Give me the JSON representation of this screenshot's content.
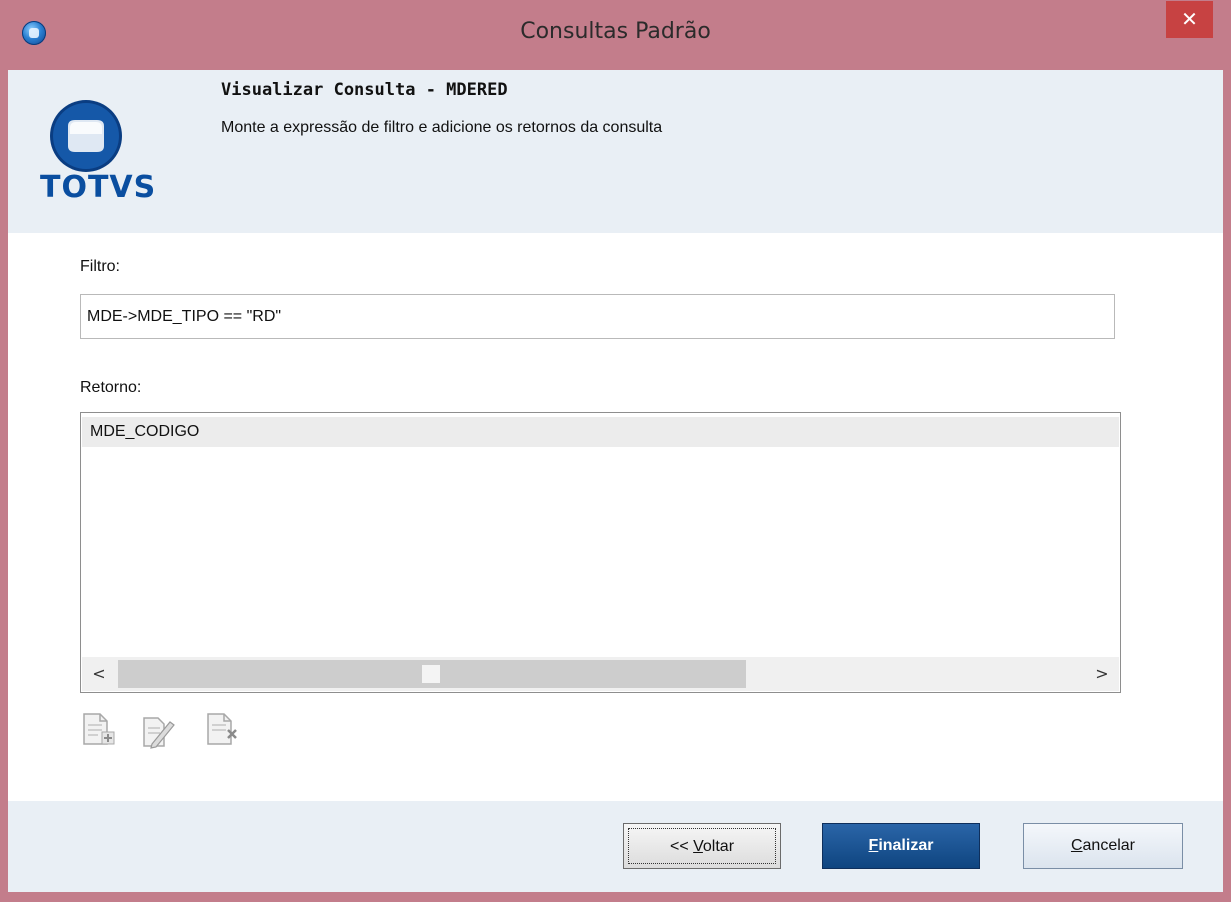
{
  "window": {
    "title": "Consultas Padrão",
    "close_glyph": "✕"
  },
  "header": {
    "logo_text": "TOTVS",
    "title": "Visualizar Consulta - MDERED",
    "subtitle": "Monte a expressão de filtro e adicione os retornos da consulta"
  },
  "filter": {
    "label": "Filtro:",
    "value": "MDE->MDE_TIPO == \"RD\""
  },
  "retorno": {
    "label": "Retorno:",
    "items": [
      "MDE_CODIGO"
    ],
    "scroll_left": "<",
    "scroll_right": ">"
  },
  "toolbar": {
    "icons": [
      "add-document-icon",
      "edit-document-icon",
      "remove-document-icon"
    ]
  },
  "buttons": {
    "back": {
      "prefix": "<< ",
      "mnemonic": "V",
      "rest": "oltar"
    },
    "finish": {
      "mnemonic": "F",
      "rest": "inalizar"
    },
    "cancel": {
      "mnemonic": "C",
      "rest": "ancelar"
    }
  },
  "colors": {
    "titlebar": "#c37d8b",
    "close": "#c74242",
    "band": "#e9eff5",
    "brand": "#0a4ea0",
    "primary_button": "#1a5595"
  }
}
